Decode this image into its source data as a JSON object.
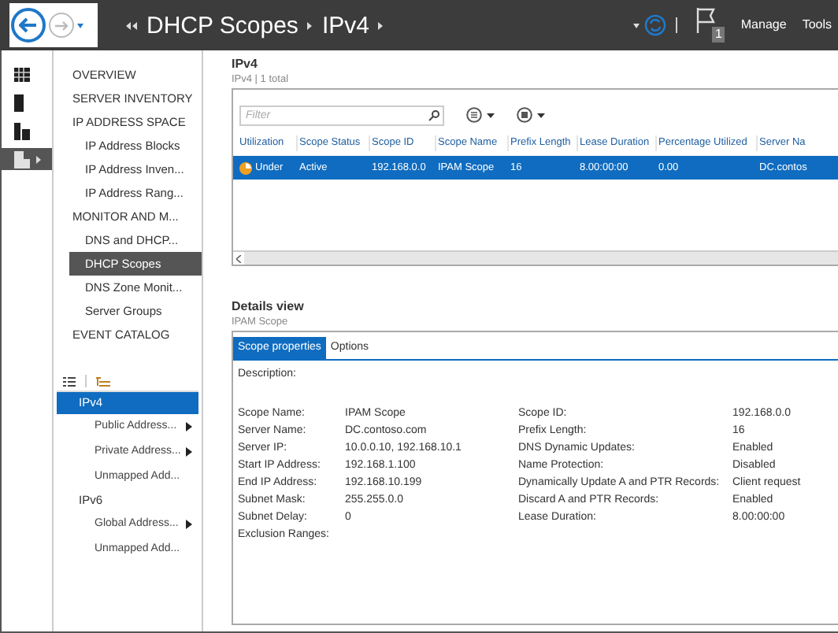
{
  "titlebar": {
    "breadcrumb": [
      {
        "label": "DHCP Scopes"
      },
      {
        "label": "IPv4"
      }
    ],
    "notification_count": "1",
    "menus": [
      "Manage",
      "Tools"
    ]
  },
  "rail": [
    {
      "kind": "dashboard",
      "selected": false
    },
    {
      "kind": "server",
      "selected": false
    },
    {
      "kind": "servers",
      "selected": false
    },
    {
      "kind": "ipam",
      "selected": true
    }
  ],
  "nav": [
    {
      "label": "OVERVIEW",
      "indent": false,
      "selected": false
    },
    {
      "label": "SERVER INVENTORY",
      "indent": false,
      "selected": false
    },
    {
      "label": "IP ADDRESS SPACE",
      "indent": false,
      "selected": false
    },
    {
      "label": "IP Address Blocks",
      "indent": true,
      "selected": false
    },
    {
      "label": "IP Address Inven...",
      "indent": true,
      "selected": false
    },
    {
      "label": "IP Address Rang...",
      "indent": true,
      "selected": false
    },
    {
      "label": "MONITOR AND M...",
      "indent": false,
      "selected": false
    },
    {
      "label": "DNS and DHCP...",
      "indent": true,
      "selected": false
    },
    {
      "label": "DHCP Scopes",
      "indent": true,
      "selected": true
    },
    {
      "label": "DNS Zone Monit...",
      "indent": true,
      "selected": false
    },
    {
      "label": "Server Groups",
      "indent": true,
      "selected": false
    },
    {
      "label": "EVENT CATALOG",
      "indent": false,
      "selected": false
    }
  ],
  "tree": [
    {
      "label": "IPv4",
      "selected": true,
      "children": [
        {
          "label": "Public Address...",
          "expandable": true
        },
        {
          "label": "Private Address...",
          "expandable": true
        },
        {
          "label": "Unmapped Add...",
          "expandable": false
        }
      ]
    },
    {
      "label": "IPv6",
      "selected": false,
      "children": [
        {
          "label": "Global Address...",
          "expandable": true
        },
        {
          "label": "Unmapped Add...",
          "expandable": false
        }
      ]
    }
  ],
  "list": {
    "title": "IPv4",
    "subtitle": "IPv4 | 1 total",
    "filter": {
      "placeholder": "Filter"
    },
    "columns": [
      "Utilization",
      "Scope Status",
      "Scope ID",
      "Scope Name",
      "Prefix Length",
      "Lease Duration",
      "Percentage Utilized",
      "Server Na"
    ],
    "rows": [
      {
        "selected": true,
        "cells": [
          "Under",
          "Active",
          "192.168.0.0",
          "IPAM Scope",
          "16",
          "8.00:00:00",
          "0.00",
          "DC.contos"
        ]
      }
    ]
  },
  "details": {
    "title": "Details view",
    "subtitle": "IPAM Scope",
    "tabs": [
      {
        "label": "Scope properties",
        "selected": true
      },
      {
        "label": "Options",
        "selected": false
      }
    ],
    "description_label": "Description:",
    "left": [
      {
        "label": "Scope Name:",
        "value": "IPAM Scope"
      },
      {
        "label": "Server Name:",
        "value": "DC.contoso.com"
      },
      {
        "label": "Server IP:",
        "value": "10.0.0.10, 192.168.10.1"
      },
      {
        "label": "Start IP Address:",
        "value": "192.168.1.100"
      },
      {
        "label": "End IP Address:",
        "value": "192.168.10.199"
      },
      {
        "label": "Subnet Mask:",
        "value": "255.255.0.0"
      },
      {
        "label": "Subnet Delay:",
        "value": "0"
      },
      {
        "label": "Exclusion Ranges:"
      }
    ],
    "right": [
      {
        "label": "Scope ID:",
        "value": "192.168.0.0"
      },
      {
        "label": "Prefix Length:",
        "value": "16"
      },
      {
        "label": "DNS Dynamic Updates:",
        "value": "Enabled"
      },
      {
        "label": "Name Protection:",
        "value": "Disabled"
      },
      {
        "label": "Dynamically Update A and PTR Records:",
        "value": "Client request"
      },
      {
        "label": "Discard A and PTR Records:",
        "value": "Enabled"
      },
      {
        "label": "Lease Duration:",
        "value": "8.00:00:00"
      }
    ]
  }
}
